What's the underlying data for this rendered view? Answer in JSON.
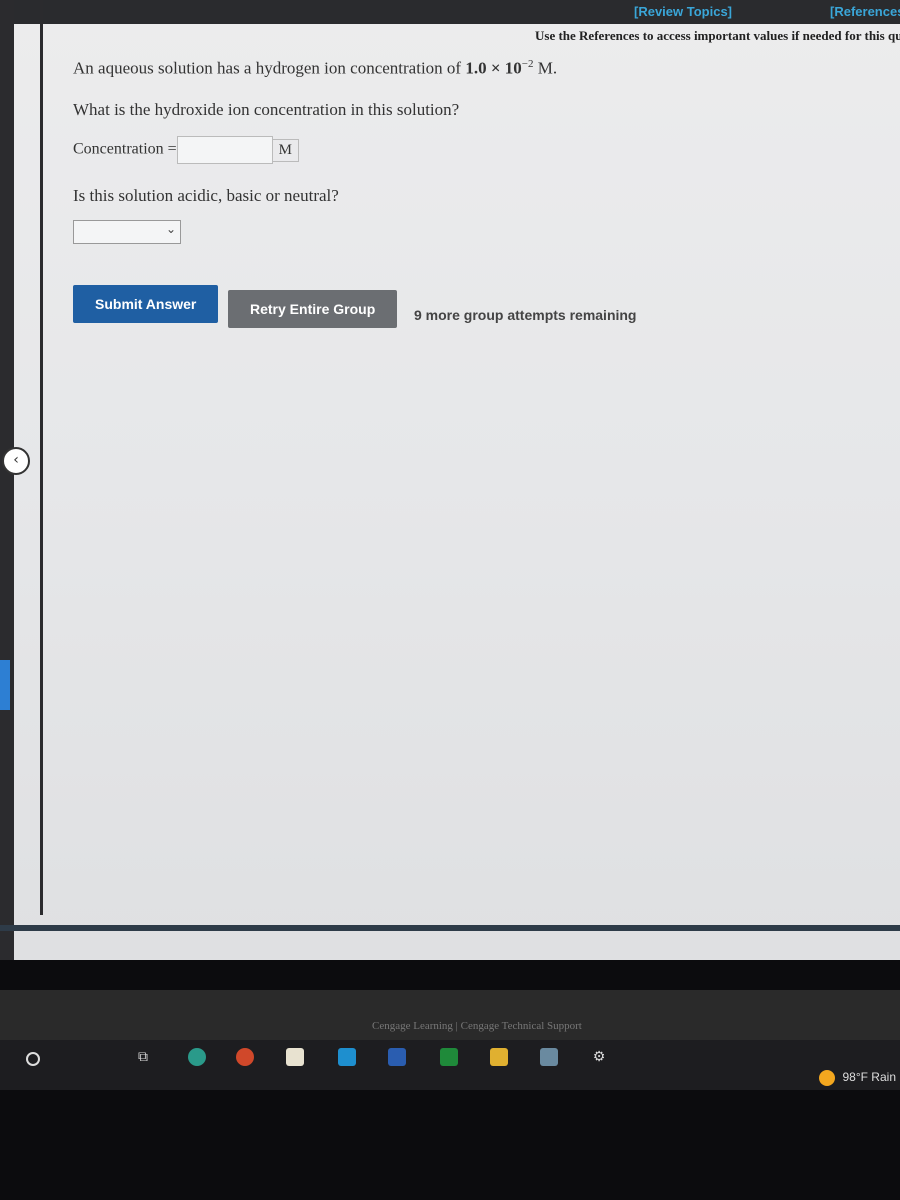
{
  "header": {
    "review_topics": "[Review Topics]",
    "references": "[References]",
    "note": "Use the References to access important values if needed for this question."
  },
  "question": {
    "prompt_prefix": "An aqueous solution has a hydrogen ion concentration of ",
    "coefficient": "1.0 × 10",
    "exponent": "−2",
    "unit_suffix": " M.",
    "q1": "What is the hydroxide ion concentration in this solution?",
    "concentration_label": "Concentration =",
    "concentration_value": "",
    "concentration_unit": "M",
    "q2": "Is this solution acidic, basic or neutral?",
    "select_value": ""
  },
  "actions": {
    "submit": "Submit Answer",
    "retry": "Retry Entire Group",
    "attempts": "9 more group attempts remaining"
  },
  "footer": {
    "links": "Cengage Learning | Cengage Technical Support"
  },
  "taskbar": {
    "icons": [
      "cortana-icon",
      "task-view-icon",
      "edge-icon",
      "powerpoint-icon",
      "store-icon",
      "mail-icon",
      "word-icon",
      "excel-icon",
      "file-explorer-icon",
      "calculator-icon",
      "settings-icon"
    ],
    "weather": "98°F Rain"
  },
  "colors": {
    "link": "#3aa6d8",
    "submit": "#1f5fa3",
    "retry": "#6b6e72"
  }
}
